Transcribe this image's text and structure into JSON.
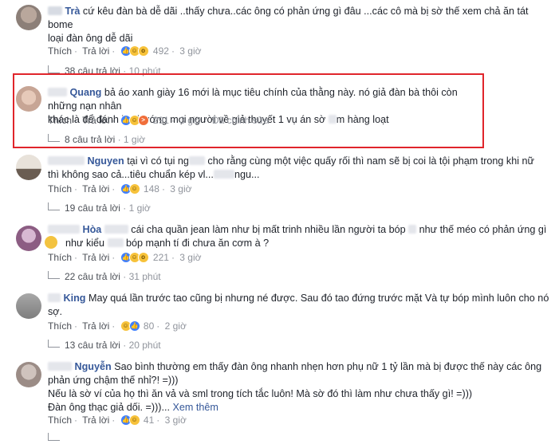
{
  "comments": [
    {
      "name": "Trà",
      "line1": "cứ kêu đàn bà dễ dãi ..thấy chưa..các ông có phản ứng gì đâu ...các cô mà bị sờ thế xem chả ăn tát",
      "line2": "bome",
      "line3": "loại đàn ông dễ dãi",
      "like": "Thích",
      "reply": "Trả lời",
      "count": "492",
      "time": "3 giờ",
      "replies": "38 câu trả lời",
      "replies_time": "10 phút"
    },
    {
      "name": "Quang",
      "line1": "bả áo xanh giày 16 mới là mục tiêu chính của thằng này. nó giả đàn bà thôi còn những nạn nhân",
      "line2a": "khác là để đánh lạc hướng mọi người về giả thuyết 1 vụ án sờ",
      "line2b": "m hàng loạt",
      "like": "Thích",
      "reply": "Trả lời",
      "count": "291",
      "time": "3 giờ",
      "edited": "Đã chỉnh sửa",
      "replies": "8 câu trả lời",
      "replies_time": "1 giờ"
    },
    {
      "name": "Nguyen",
      "line1a": "tại vì có tụi ng",
      "line1b": "cho rằng cùng một việc quấy rối thì nam sẽ bị coi là tội phạm trong khi nữ",
      "line2a": "thì không sao cả...tiêu chuẩn kép vl...",
      "line2b": "ngu...",
      "like": "Thích",
      "reply": "Trả lời",
      "count": "148",
      "time": "3 giờ",
      "replies": "19 câu trả lời",
      "replies_time": "1 giờ"
    },
    {
      "name": "Hòa",
      "line1a": "cái cha quần jean làm như bị mất trinh nhiều lần người ta bóp",
      "line1b": "như thế méo có phản ứng gì",
      "line2": "như kiểu",
      "line2b": "bóp mạnh tí đi chưa ăn cơm à ?",
      "like": "Thích",
      "reply": "Trả lời",
      "count": "221",
      "time": "3 giờ",
      "replies": "22 câu trả lời",
      "replies_time": "31 phút"
    },
    {
      "name": "King",
      "line1": "May quá lần trước tao cũng bị nhưng né được. Sau đó tao đứng trước mặt Và tự bóp mình luôn cho nó",
      "line2": "sợ.",
      "like": "Thích",
      "reply": "Trả lời",
      "count": "80",
      "time": "2 giờ",
      "replies": "13 câu trả lời",
      "replies_time": "20 phút"
    },
    {
      "name": "Nguyễn",
      "line1": "Sao bình thường em thấy đàn ông nhanh nhẹn hơn phụ nữ 1 tỷ lần mà bị được thế này các ông",
      "line2": "phản ứng chậm thế nhỉ?! =)))",
      "line3": "Nếu là sờ ví của họ thì ăn vả và sml trong tích tắc luôn! Mà sờ đó thì làm như chưa thấy gì! =)))",
      "line4": "Đàn ông thạc giả dối. =)))...",
      "see_more": "Xem thêm",
      "like": "Thích",
      "reply": "Trả lời",
      "count": "41",
      "time": "3 giờ"
    }
  ],
  "colors": {
    "link": "#365899",
    "meta": "#90949c",
    "highlight": "#e0252b"
  }
}
